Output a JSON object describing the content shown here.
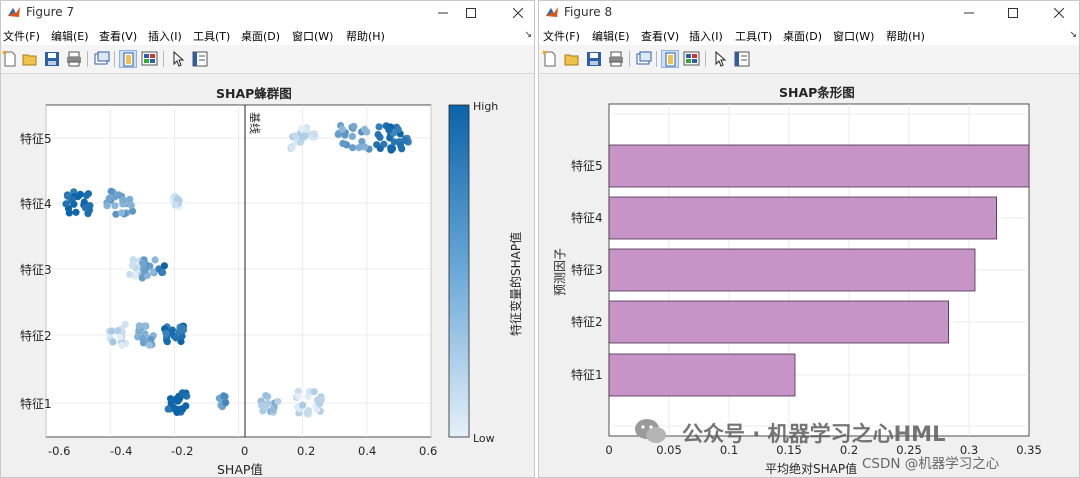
{
  "colors": {
    "bar": "#c794c8",
    "barEdge": "#4a2a4a",
    "low": "#e6f0f9",
    "high": "#0b63a8",
    "axis": "#262626"
  },
  "menu": [
    "文件(F)",
    "编辑(E)",
    "查看(V)",
    "插入(I)",
    "工具(T)",
    "桌面(D)",
    "窗口(W)",
    "帮助(H)"
  ],
  "fig7": {
    "window_title": "Figure 7",
    "plot_title": "SHAP蜂群图",
    "xlabel": "SHAP值",
    "baseline_label": "基线",
    "colorbar_label": "特征变量的SHAP值",
    "colorbar_high": "High",
    "colorbar_low": "Low",
    "features": [
      "特征5",
      "特征4",
      "特征3",
      "特征2",
      "特征1"
    ],
    "xticks": [
      "-0.6",
      "-0.4",
      "-0.2",
      "0",
      "0.2",
      "0.4",
      "0.6"
    ]
  },
  "fig8": {
    "window_title": "Figure 8",
    "plot_title": "SHAP条形图",
    "xlabel": "平均绝对SHAP值",
    "ylabel": "预测因子",
    "xticks": [
      "0",
      "0.05",
      "0.1",
      "0.15",
      "0.2",
      "0.25",
      "0.3",
      "0.35"
    ]
  },
  "chart_data": [
    {
      "type": "scatter",
      "title": "SHAP蜂群图",
      "xlabel": "SHAP值",
      "ylabel": "",
      "xlim": [
        -0.6,
        0.6
      ],
      "categories": [
        "特征5",
        "特征4",
        "特征3",
        "特征2",
        "特征1"
      ],
      "baseline": 0,
      "colorbar": {
        "label": "特征变量的SHAP值",
        "high": "High",
        "low": "Low"
      },
      "clusters": [
        {
          "feature": "特征5",
          "x_range": [
            0.16,
            0.54
          ],
          "groups": [
            {
              "center": 0.2,
              "spread": 0.04,
              "n": 22,
              "shade": 0.15
            },
            {
              "center": 0.36,
              "spread": 0.05,
              "n": 22,
              "shade": 0.55
            },
            {
              "center": 0.48,
              "spread": 0.05,
              "n": 28,
              "shade": 0.9
            }
          ]
        },
        {
          "feature": "特征4",
          "x_range": [
            -0.55,
            -0.17
          ],
          "groups": [
            {
              "center": -0.5,
              "spread": 0.04,
              "n": 22,
              "shade": 0.95
            },
            {
              "center": -0.37,
              "spread": 0.04,
              "n": 24,
              "shade": 0.55
            },
            {
              "center": -0.19,
              "spread": 0.015,
              "n": 12,
              "shade": 0.15
            }
          ]
        },
        {
          "feature": "特征3",
          "x_range": [
            -0.36,
            -0.23
          ],
          "groups": [
            {
              "center": -0.32,
              "spread": 0.02,
              "n": 12,
              "shade": 0.15
            },
            {
              "center": -0.28,
              "spread": 0.02,
              "n": 16,
              "shade": 0.55
            },
            {
              "center": -0.24,
              "spread": 0.01,
              "n": 4,
              "shade": 0.95
            }
          ]
        },
        {
          "feature": "特征2",
          "x_range": [
            -0.41,
            -0.13
          ],
          "groups": [
            {
              "center": -0.38,
              "spread": 0.03,
              "n": 14,
              "shade": 0.15
            },
            {
              "center": -0.29,
              "spread": 0.03,
              "n": 18,
              "shade": 0.5
            },
            {
              "center": -0.2,
              "spread": 0.03,
              "n": 22,
              "shade": 0.9
            }
          ]
        },
        {
          "feature": "特征1",
          "x_range": [
            -0.22,
            0.27
          ],
          "groups": [
            {
              "center": -0.19,
              "spread": 0.03,
              "n": 24,
              "shade": 1.0
            },
            {
              "center": -0.05,
              "spread": 0.01,
              "n": 12,
              "shade": 0.6
            },
            {
              "center": 0.1,
              "spread": 0.03,
              "n": 14,
              "shade": 0.35
            },
            {
              "center": 0.22,
              "spread": 0.04,
              "n": 22,
              "shade": 0.12
            }
          ]
        }
      ]
    },
    {
      "type": "bar",
      "orientation": "horizontal",
      "title": "SHAP条形图",
      "xlabel": "平均绝对SHAP值",
      "ylabel": "预测因子",
      "xlim": [
        0,
        0.35
      ],
      "categories": [
        "特征5",
        "特征4",
        "特征3",
        "特征2",
        "特征1"
      ],
      "values": [
        0.35,
        0.323,
        0.305,
        0.283,
        0.155
      ]
    }
  ],
  "watermark": {
    "wechat": "公众号 · 机器学习之心HML",
    "csdn": "CSDN @机器学习之心"
  }
}
